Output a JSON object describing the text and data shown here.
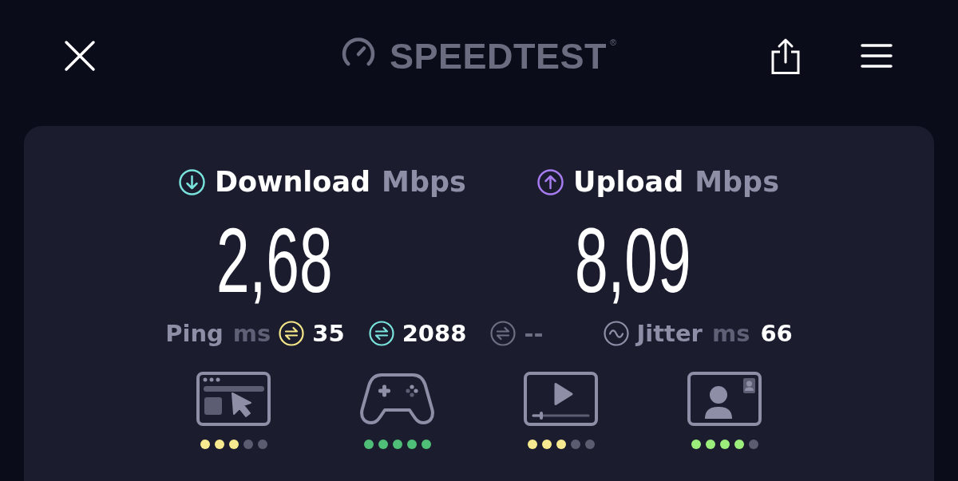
{
  "header": {
    "logo_text": "SPEEDTEST",
    "logo_mark": "®"
  },
  "results": [
    {
      "kind": "download",
      "label": "Download",
      "unit": "Mbps",
      "value": "2,68",
      "color": "#79e3dc"
    },
    {
      "kind": "upload",
      "label": "Upload",
      "unit": "Mbps",
      "value": "8,09",
      "color": "#a67cf0"
    }
  ],
  "ping": {
    "label": "Ping",
    "unit": "ms",
    "readings": [
      {
        "value": "35",
        "color": "#f5e68a",
        "dimmed": false
      },
      {
        "value": "2088",
        "color": "#79e3dc",
        "dimmed": false
      },
      {
        "value": "--",
        "color": "#6d6e82",
        "dimmed": true
      }
    ]
  },
  "jitter": {
    "label": "Jitter",
    "unit": "ms",
    "value": "66"
  },
  "quality": [
    {
      "kind": "browsing",
      "stars": 3,
      "color": "#f6e98f"
    },
    {
      "kind": "gaming",
      "stars": 5,
      "color": "#4fbf77"
    },
    {
      "kind": "streaming",
      "stars": 3,
      "color": "#f6e98f"
    },
    {
      "kind": "video_call",
      "stars": 4,
      "color": "#9cee7c"
    }
  ]
}
